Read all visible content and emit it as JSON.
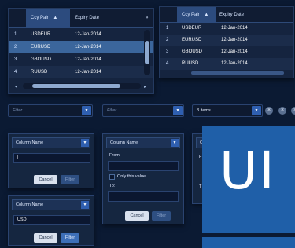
{
  "grid1": {
    "columns": [
      "Ccy Pair",
      "Expiry Date"
    ],
    "sort_indicator": "▲",
    "overflow_glyph": "»",
    "rows": [
      {
        "num": "1",
        "pair": "USDEUR",
        "date": "12-Jan-2014"
      },
      {
        "num": "2",
        "pair": "EURUSD",
        "date": "12-Jan-2014"
      },
      {
        "num": "3",
        "pair": "GBOUSD",
        "date": "12-Jan-2014"
      },
      {
        "num": "4",
        "pair": "RUUSD",
        "date": "12-Jan-2014"
      }
    ],
    "scroll_left": "◂",
    "scroll_right": "▸"
  },
  "grid2": {
    "columns": [
      "Ccy Pair",
      "Expiry Date"
    ],
    "sort_indicator": "▲",
    "rows": [
      {
        "num": "1",
        "pair": "USDEUR",
        "date": "12-Jan-2014"
      },
      {
        "num": "2",
        "pair": "EURUSD",
        "date": "12-Jan-2014"
      },
      {
        "num": "3",
        "pair": "GBOUSD",
        "date": "12-Jan-2014"
      },
      {
        "num": "4",
        "pair": "RUUSD",
        "date": "12-Jan-2014"
      }
    ]
  },
  "filters": {
    "filter1_placeholder": "Filter...",
    "filter2_placeholder": "Filter...",
    "items_value": "3 items",
    "dropdown_glyph": "▼",
    "clear_glyph": "×"
  },
  "panel1": {
    "header": "Column Name",
    "input_value": "|",
    "cancel": "Cancel",
    "filter": "Filter"
  },
  "panel2": {
    "header": "Column Name",
    "from_label": "From:",
    "from_value": "|",
    "only_value_label": "Only this value",
    "to_label": "To:",
    "cancel": "Cancel",
    "filter": "Filter"
  },
  "panel3": {
    "header": "Column Name",
    "input_value": "USD",
    "cancel": "Cancel",
    "filter": "Filter"
  },
  "panel4": {
    "header_partial": "Co",
    "partial_letters": [
      "F",
      "T"
    ]
  },
  "tile": {
    "text": "UI"
  }
}
